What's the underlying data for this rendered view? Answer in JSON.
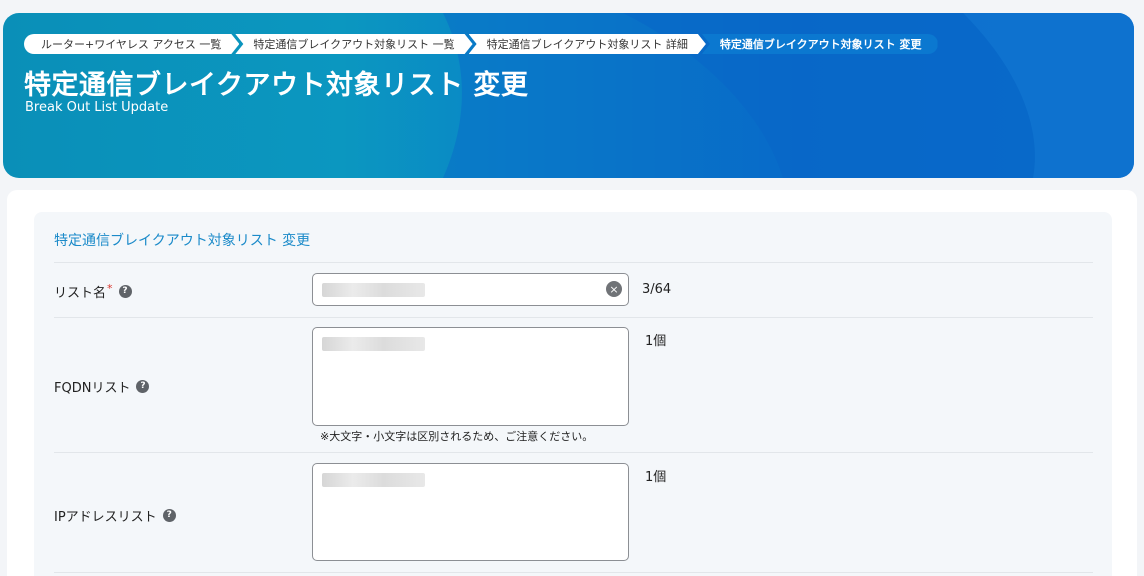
{
  "breadcrumb": [
    {
      "label": "ルーター+ワイヤレス アクセス 一覧"
    },
    {
      "label": "特定通信ブレイクアウト対象リスト 一覧"
    },
    {
      "label": "特定通信ブレイクアウト対象リスト 詳細"
    },
    {
      "label": "特定通信ブレイクアウト対象リスト 変更"
    }
  ],
  "header": {
    "title": "特定通信ブレイクアウト対象リスト 変更",
    "subtitle": "Break Out List Update"
  },
  "form": {
    "section_title": "特定通信ブレイクアウト対象リスト 変更",
    "list_name": {
      "label": "リスト名",
      "required_mark": "*",
      "help_icon": "?",
      "clear_icon": "×",
      "counter": "3/64"
    },
    "fqdn_list": {
      "label": "FQDNリスト",
      "help_icon": "?",
      "counter": "1個",
      "note": "※大文字・小文字は区別されるため、ご注意ください。"
    },
    "ip_list": {
      "label": "IPアドレスリスト",
      "help_icon": "?",
      "counter": "1個"
    }
  },
  "colors": {
    "header_start": "#0a8fb8",
    "header_end": "#0a6fd0",
    "current_crumb": "#0b78d0",
    "section_title": "#1a8ac9",
    "required": "#d9342b"
  },
  "icons": {
    "help": "question-circle-icon",
    "clear": "clear-circle-icon"
  }
}
